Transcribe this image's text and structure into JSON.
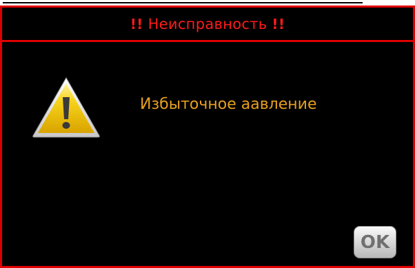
{
  "dialog": {
    "title_marker": "!!",
    "title": "Неисправность",
    "message": "Избыточное аавление",
    "ok_label": "OK",
    "icon": "warning-icon"
  },
  "colors": {
    "background": "#000000",
    "border": "#e00000",
    "title_text": "#ff1a1a",
    "message_text": "#e8a020",
    "warning_fill": "#f5c400"
  }
}
